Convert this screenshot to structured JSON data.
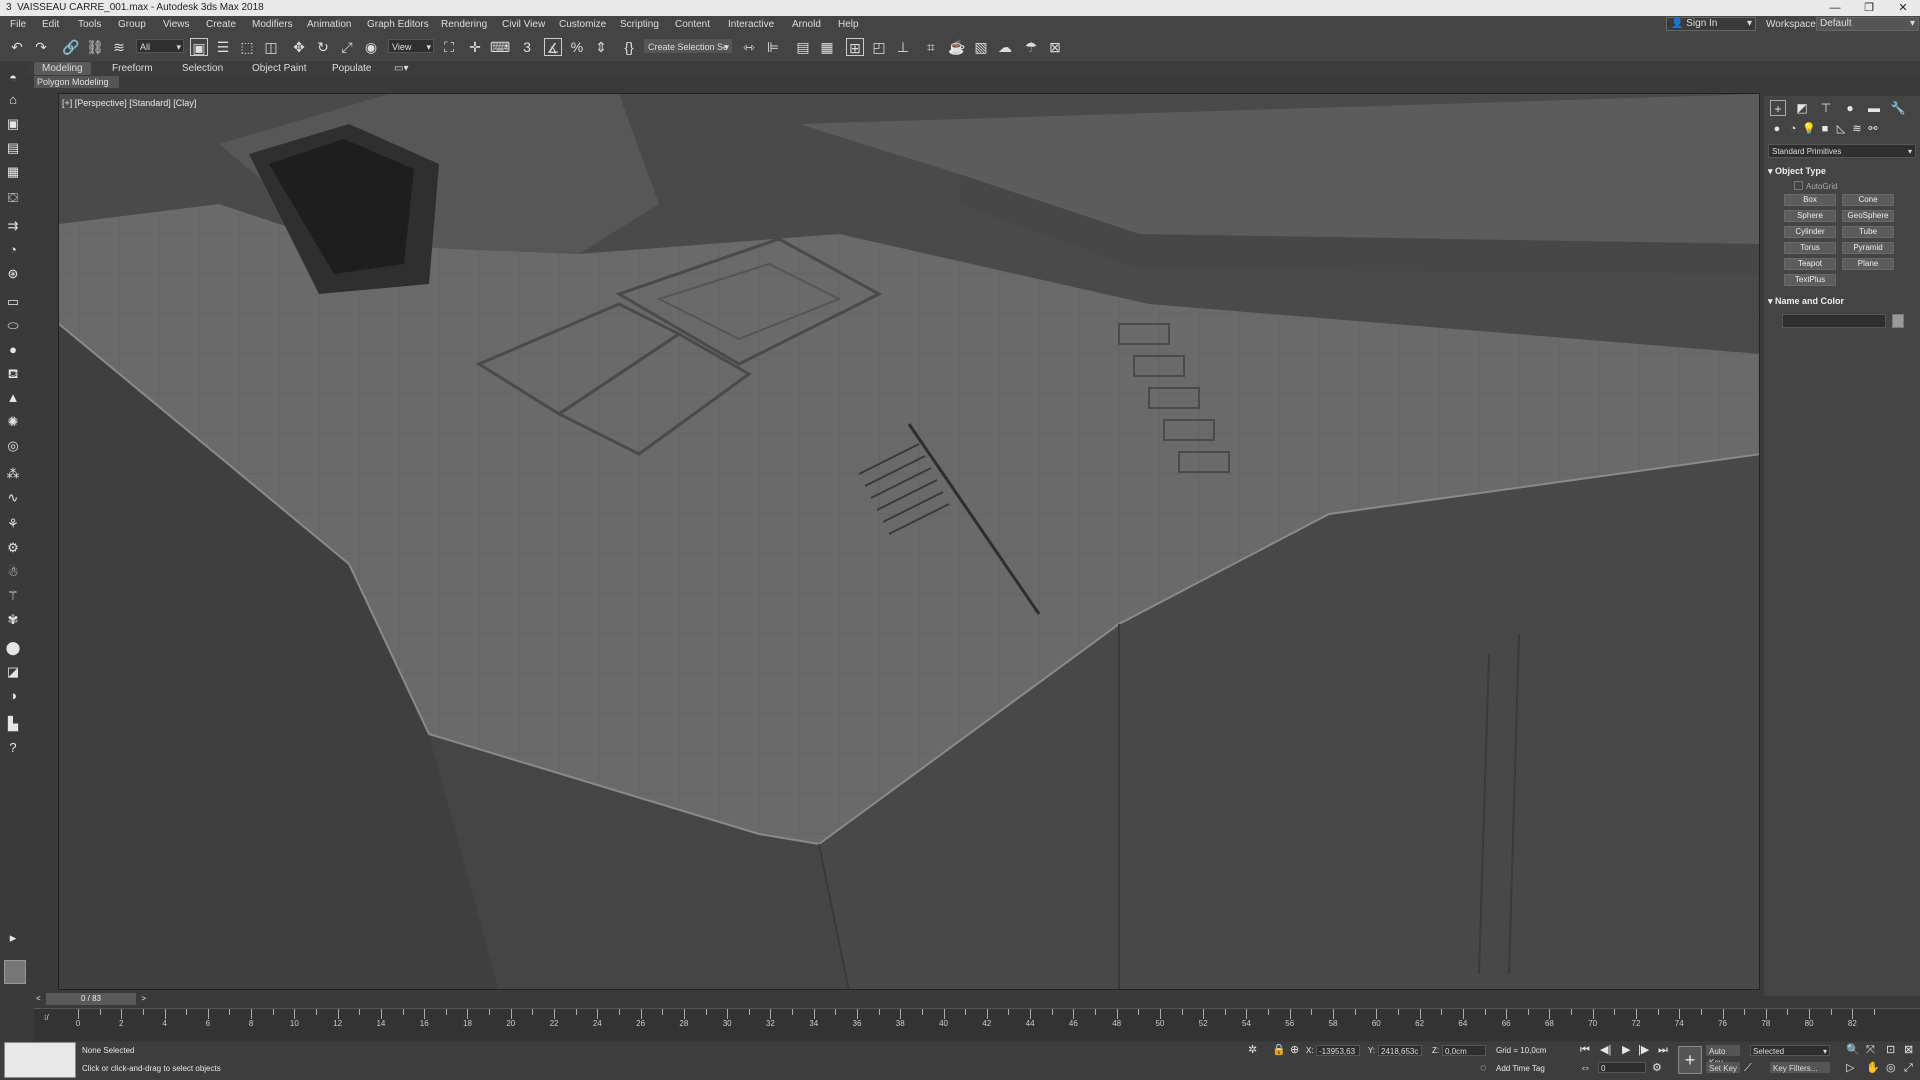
{
  "window": {
    "title": "VAISSEAU CARRE_001.max - Autodesk 3ds Max 2018",
    "icon": "3",
    "controls": {
      "minimize": "—",
      "restore": "❐",
      "close": "✕"
    }
  },
  "menu": [
    "File",
    "Edit",
    "Tools",
    "Group",
    "Views",
    "Create",
    "Modifiers",
    "Animation",
    "Graph Editors",
    "Rendering",
    "Civil View",
    "Customize",
    "Scripting",
    "Content",
    "Interactive",
    "Arnold",
    "Help"
  ],
  "account": {
    "sign_in": "Sign In",
    "workspaces_label": "Workspaces:",
    "workspace": "Default"
  },
  "toolbar": {
    "filter": "All",
    "ref_coord": "View",
    "named_selection": "Create Selection Se"
  },
  "ribbon": {
    "tabs": [
      "Modeling",
      "Freeform",
      "Selection",
      "Object Paint",
      "Populate"
    ],
    "active_tab": "Modeling",
    "sub_panel": "Polygon Modeling"
  },
  "viewport": {
    "label": "[+] [Perspective] [Standard] [Clay]"
  },
  "command_panel": {
    "category": "Standard Primitives",
    "object_type": {
      "header": "Object Type",
      "autogrid": "AutoGrid",
      "buttons": [
        "Box",
        "Cone",
        "Sphere",
        "GeoSphere",
        "Cylinder",
        "Tube",
        "Torus",
        "Pyramid",
        "Teapot",
        "Plane",
        "TextPlus"
      ]
    },
    "name_color": {
      "header": "Name and Color"
    }
  },
  "timeline": {
    "frame_display": "0 / 83",
    "ticks": [
      0,
      2,
      4,
      6,
      8,
      10,
      12,
      14,
      16,
      18,
      20,
      22,
      24,
      26,
      28,
      30,
      32,
      34,
      36,
      38,
      40,
      42,
      44,
      46,
      48,
      50,
      52,
      54,
      56,
      58,
      60,
      62,
      64,
      66,
      68,
      70,
      72,
      74,
      76,
      78,
      80,
      82
    ]
  },
  "status": {
    "selection": "None Selected",
    "prompt": "Click or click-and-drag to select objects",
    "x_label": "X:",
    "x_value": "-13953,63",
    "y_label": "Y:",
    "y_value": "2418,653c",
    "z_label": "Z:",
    "z_value": "0,0cm",
    "grid": "Grid = 10,0cm",
    "add_time_tag": "Add Time Tag",
    "auto_key": "Auto Key",
    "set_key": "Set Key",
    "key_mode": "Selected",
    "key_filters": "Key Filters...",
    "current_frame": "0"
  }
}
